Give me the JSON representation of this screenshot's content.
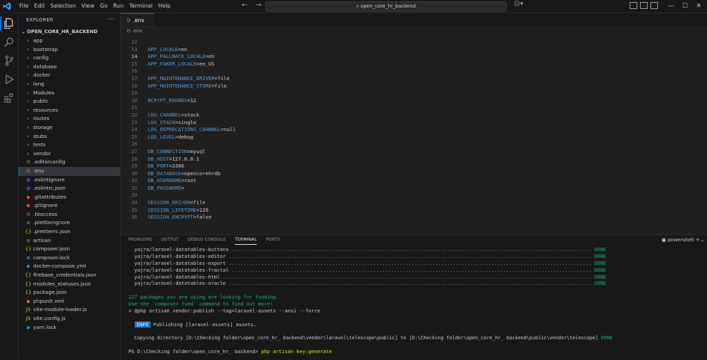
{
  "menu": [
    "File",
    "Edit",
    "Selection",
    "View",
    "Go",
    "Run",
    "Terminal",
    "Help"
  ],
  "search_text": "open_core_hr_backend",
  "explorer": {
    "header": "EXPLORER",
    "root": "OPEN_CORE_HR_BACKEND",
    "folders": [
      "app",
      "bootstrap",
      "config",
      "database",
      "docker",
      "lang",
      "Modules",
      "public",
      "resources",
      "routes",
      "storage",
      "stubs",
      "tests",
      "vendor"
    ],
    "files": [
      ".editorconfig",
      ".env",
      ".eslintignore",
      ".eslintrc.json",
      ".gitattributes",
      ".gitignore",
      ".htaccess",
      ".prettierignore",
      ".prettierrc.json",
      "artisan",
      "composer.json",
      "composer.lock",
      "docker-compose.yml",
      "firebase_credentials.json",
      "modules_statuses.json",
      "package.json",
      "phpunit.xml",
      "vite-module-loader.js",
      "vite.config.js",
      "yarn.lock"
    ]
  },
  "editor": {
    "tab": ".env",
    "breadcrumb": ".env",
    "lines": [
      {
        "n": "12",
        "key": "",
        "val": ""
      },
      {
        "n": "13",
        "key": "APP_LOCALE",
        "val": "en"
      },
      {
        "n": "14",
        "key": "APP_FALLBACK_LOCALE",
        "val": "en"
      },
      {
        "n": "15",
        "key": "APP_FAKER_LOCALE",
        "val": "en_US"
      },
      {
        "n": "16",
        "key": "",
        "val": ""
      },
      {
        "n": "17",
        "key": "APP_MAINTENANCE_DRIVER",
        "val": "file"
      },
      {
        "n": "18",
        "key": "APP_MAINTENANCE_STORE",
        "val": "file"
      },
      {
        "n": "19",
        "key": "",
        "val": ""
      },
      {
        "n": "20",
        "key": "BCRYPT_ROUNDS",
        "val": "12"
      },
      {
        "n": "21",
        "key": "",
        "val": ""
      },
      {
        "n": "22",
        "key": "LOG_CHANNEL",
        "val": "stack"
      },
      {
        "n": "23",
        "key": "LOG_STACK",
        "val": "single"
      },
      {
        "n": "24",
        "key": "LOG_DEPRECATIONS_CHANNEL",
        "val": "null"
      },
      {
        "n": "25",
        "key": "LOG_LEVEL",
        "val": "debug"
      },
      {
        "n": "26",
        "key": "",
        "val": ""
      },
      {
        "n": "27",
        "key": "DB_CONNECTION",
        "val": "mysql"
      },
      {
        "n": "28",
        "key": "DB_HOST",
        "val": "127.0.0.1"
      },
      {
        "n": "29",
        "key": "DB_PORT",
        "val": "3306"
      },
      {
        "n": "30",
        "key": "DB_DATABASE",
        "val": "opencorehrdb"
      },
      {
        "n": "31",
        "key": "DB_USERNAME",
        "val": "root"
      },
      {
        "n": "32",
        "key": "DB_PASSWORD",
        "val": ""
      },
      {
        "n": "33",
        "key": "",
        "val": ""
      },
      {
        "n": "34",
        "key": "SESSION_DRIVER",
        "val": "file"
      },
      {
        "n": "35",
        "key": "SESSION_LIFETIME",
        "val": "120"
      },
      {
        "n": "36",
        "key": "SESSION_ENCRYPT",
        "val": "false"
      }
    ]
  },
  "panel": {
    "tabs": [
      "PROBLEMS",
      "OUTPUT",
      "DEBUG CONSOLE",
      "TERMINAL",
      "PORTS"
    ],
    "active_tab": "TERMINAL",
    "shell": "powershell",
    "publish_lines": [
      "yajra/laravel-datatables-buttons",
      "yajra/laravel-datatables-editor",
      "yajra/laravel-datatables-export",
      "yajra/laravel-datatables-fractal",
      "yajra/laravel-datatables-html",
      "yajra/laravel-datatables-oracle"
    ],
    "done_label": "DONE",
    "funding_1": "127 packages you are using are looking for funding.",
    "funding_2": "Use the `composer fund` command to find out more!",
    "publish_cmd_prompt": ">",
    "publish_cmd": "@php artisan vendor:publish --tag=laravel-assets --ansi --force",
    "info_badge": "INFO",
    "info_text": "Publishing [laravel-assets] assets.",
    "copy_text": "Copying directory [D:\\Checking folder\\open_core_hr_ backend\\vendor\\laravel\\telescope\\public] to [D:\\Checking folder\\open_core_hr_ backend\\public\\vendor\\telescope]",
    "prompt": "PS D:\\Checking folder\\open_core_hr_ backend>",
    "command": "php artisan key:generate"
  }
}
